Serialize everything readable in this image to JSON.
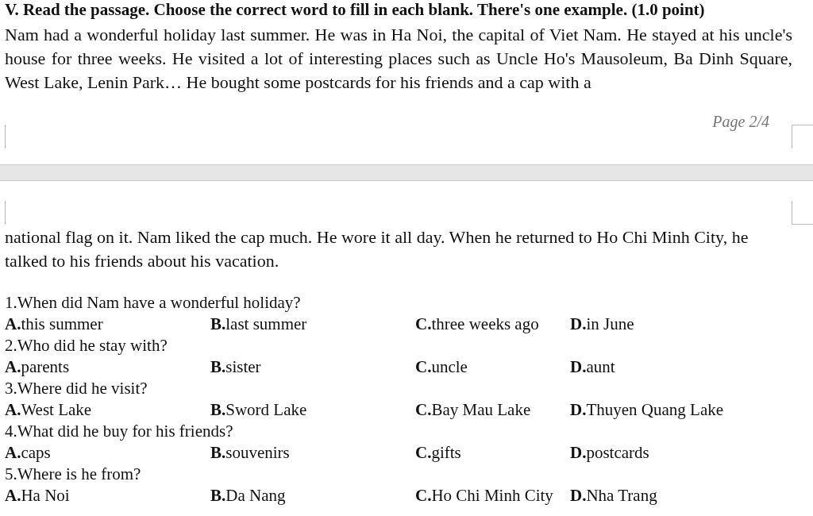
{
  "heading": "V. Read the passage. Choose the correct word to fill in each blank. There's one example. (1.0 point)",
  "passage_part_1": "Nam had a wonderful holiday last summer. He was in Ha Noi, the capital of Viet Nam. He stayed at his uncle's house for three weeks. He visited a lot of interesting places such as Uncle Ho's Mausoleum, Ba Dinh Square, West Lake, Lenin Park… He bought some postcards for his friends and a cap with a",
  "page_number": "Page 2/4",
  "passage_part_2": "national flag on it. Nam liked the cap much. He wore it all day. When he returned to Ho Chi Minh City, he talked to his friends about his vacation.",
  "questions": [
    {
      "question": "1.When did Nam have a wonderful holiday?",
      "options": [
        "**A.**this summer",
        "**B.**last summer",
        "**C.**three weeks ago",
        "**D.**in June"
      ]
    },
    {
      "question": "2.Who did he stay with?",
      "options": [
        "**A.**parents",
        "**B.**sister",
        "**C.**uncle",
        "**D.**aunt"
      ]
    },
    {
      "question": "3.Where did he visit?",
      "options": [
        "**A.**West Lake",
        "**B.**Sword Lake",
        "**C.**Bay Mau Lake",
        "**D.**Thuyen Quang Lake"
      ]
    },
    {
      "question": "4.What did he buy for his friends?",
      "options": [
        "**A.**caps",
        "**B.**souvenirs",
        "**C.**gifts",
        "**D.**postcards"
      ]
    },
    {
      "question": "5.Where is he from?",
      "options": [
        "**A.**Ha Noi",
        "**B.**Da Nang",
        "**C.**Ho Chi Minh City",
        "**D.**Nha Trang"
      ]
    }
  ]
}
